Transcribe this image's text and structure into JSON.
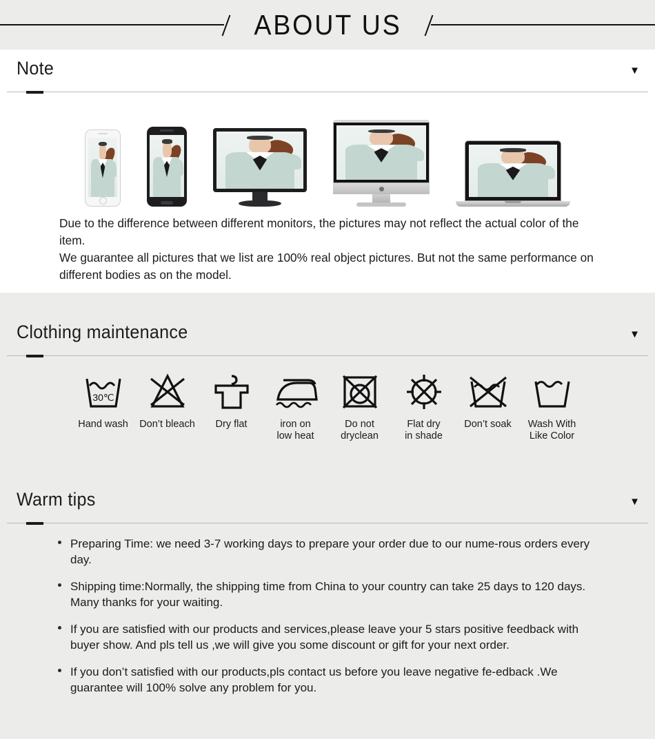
{
  "banner": {
    "title": "ABOUT US"
  },
  "sections": {
    "note": {
      "heading": "Note",
      "caret": "▼",
      "devices": [
        {
          "name": "iphone",
          "label": "white-smartphone"
        },
        {
          "name": "android",
          "label": "black-smartphone"
        },
        {
          "name": "monitor",
          "label": "desktop-monitor"
        },
        {
          "name": "imac",
          "label": "all-in-one-computer"
        },
        {
          "name": "laptop",
          "label": "laptop-computer"
        }
      ],
      "paragraph_1": "Due to the difference between different monitors, the pictures may not reflect the actual color of the item.",
      "paragraph_2": "We guarantee all pictures that we list are 100% real object pictures. But not the same performance on different bodies as on the model."
    },
    "maintenance": {
      "heading": "Clothing maintenance",
      "caret": "▼",
      "icons": [
        {
          "icon": "hand-wash-icon",
          "label": "Hand wash",
          "temp": "30℃"
        },
        {
          "icon": "do-not-bleach-icon",
          "label": "Don’t bleach"
        },
        {
          "icon": "dry-flat-icon",
          "label": "Dry flat"
        },
        {
          "icon": "iron-low-heat-icon",
          "label": "iron on\nlow heat"
        },
        {
          "icon": "do-not-dryclean-icon",
          "label": "Do not\ndryclean"
        },
        {
          "icon": "flat-dry-shade-icon",
          "label": "Flat dry\nin shade"
        },
        {
          "icon": "do-not-soak-icon",
          "label": "Don’t soak"
        },
        {
          "icon": "wash-like-color-icon",
          "label": "Wash With\nLike Color"
        }
      ]
    },
    "warm_tips": {
      "heading": "Warm tips",
      "caret": "▼",
      "tips": [
        "Preparing Time: we need 3-7 working days to prepare your order due to our nume-rous orders every day.",
        "Shipping time:Normally, the shipping time from China to your country can take 25 days to 120 days. Many thanks for your waiting.",
        "If you are satisfied with our products and services,please leave your 5 stars positive feedback with buyer show. And pls tell us ,we will give you some discount or gift for your next order.",
        "If you don’t satisfied with our products,pls contact us before you leave negative fe-edback .We guarantee will 100% solve any problem for you."
      ]
    }
  },
  "colors": {
    "page_background": "#ececeb",
    "note_background": "#ffffff",
    "text": "#1b1b1b",
    "rule": "#b9b9b9",
    "accent": "#1a1a1a"
  }
}
